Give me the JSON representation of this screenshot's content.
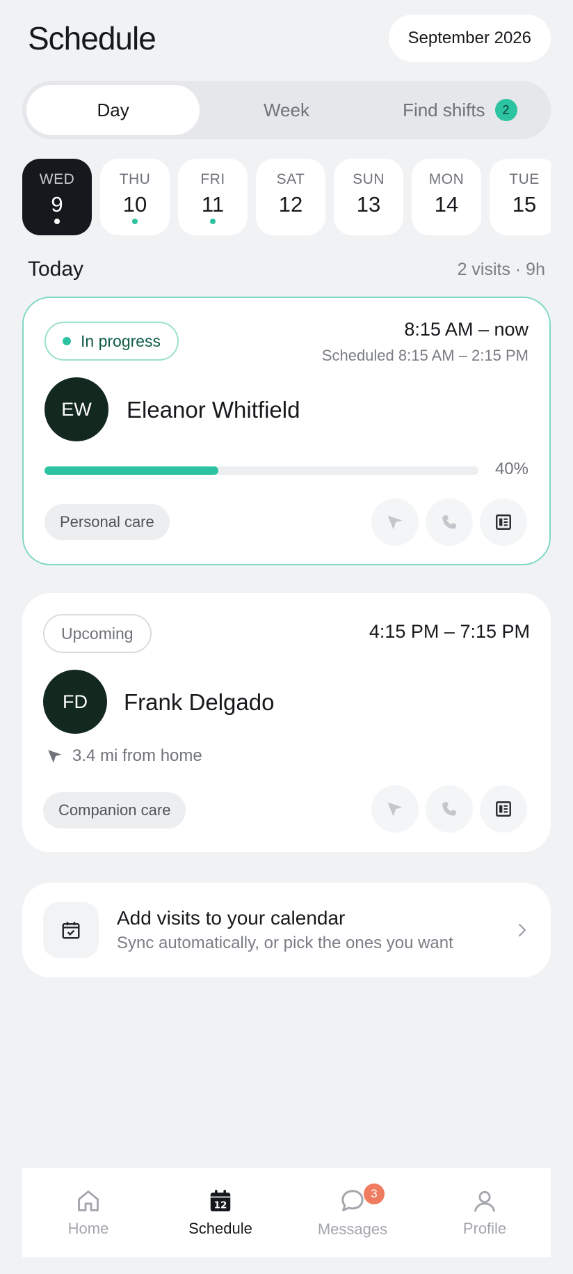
{
  "header": {
    "title": "Schedule",
    "month": "September 2026"
  },
  "segments": [
    {
      "label": "Day",
      "active": true
    },
    {
      "label": "Week",
      "active": false
    },
    {
      "label": "Find shifts",
      "active": false,
      "badge": "2"
    }
  ],
  "days": [
    {
      "dow": "WED",
      "num": "9",
      "active": true,
      "dot": true
    },
    {
      "dow": "THU",
      "num": "10",
      "active": false,
      "dot": true
    },
    {
      "dow": "FRI",
      "num": "11",
      "active": false,
      "dot": true
    },
    {
      "dow": "SAT",
      "num": "12",
      "active": false,
      "dot": false
    },
    {
      "dow": "SUN",
      "num": "13",
      "active": false,
      "dot": false
    },
    {
      "dow": "MON",
      "num": "14",
      "active": false,
      "dot": false
    },
    {
      "dow": "TUE",
      "num": "15",
      "active": false,
      "dot": false
    }
  ],
  "today": {
    "label": "Today",
    "summary": "2 visits · 9h"
  },
  "visits": [
    {
      "status": "In progress",
      "time": "8:15 AM – now",
      "scheduled": "Scheduled 8:15 AM – 2:15 PM",
      "initials": "EW",
      "name": "Eleanor Whitfield",
      "progress_fraction": 0.4,
      "progress_text": "40%",
      "care_type": "Personal care"
    },
    {
      "status": "Upcoming",
      "time": "4:15 PM – 7:15 PM",
      "initials": "FD",
      "name": "Frank Delgado",
      "distance": "3.4 mi from home",
      "care_type": "Companion care"
    }
  ],
  "promo": {
    "title": "Add visits to your calendar",
    "subtitle": "Sync automatically, or pick the ones you want"
  },
  "tabbar": {
    "items": [
      {
        "label": "Home",
        "icon": "home-icon",
        "active": false
      },
      {
        "label": "Schedule",
        "icon": "calendar-icon",
        "active": true,
        "icon_text": "12"
      },
      {
        "label": "Messages",
        "icon": "chat-icon",
        "active": false,
        "badge": "3"
      },
      {
        "label": "Profile",
        "icon": "user-icon",
        "active": false
      }
    ]
  },
  "colors": {
    "accent": "#2cc3a0",
    "dark": "#15181c",
    "badge": "#ef7c5f",
    "background": "#f1f2f4"
  }
}
